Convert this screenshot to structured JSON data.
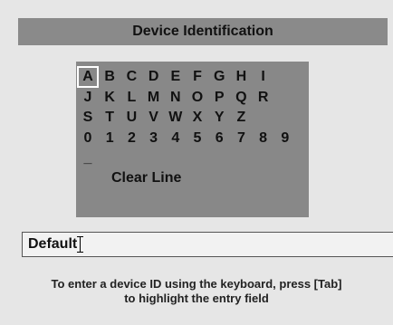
{
  "title": "Device Identification",
  "keyboard": {
    "rows": [
      [
        "A",
        "B",
        "C",
        "D",
        "E",
        "F",
        "G",
        "H",
        "I"
      ],
      [
        "J",
        "K",
        "L",
        "M",
        "N",
        "O",
        "P",
        "Q",
        "R"
      ],
      [
        "S",
        "T",
        "U",
        "V",
        "W",
        "X",
        "Y",
        "Z"
      ],
      [
        "0",
        "1",
        "2",
        "3",
        "4",
        "5",
        "6",
        "7",
        "8",
        "9"
      ],
      [
        "_"
      ]
    ],
    "selected": "A",
    "clear_line_label": "Clear Line"
  },
  "entry": {
    "value": "Default"
  },
  "instructions": {
    "line1": "To enter a device ID using the keyboard, press [Tab]",
    "line2": "to highlight the entry field"
  }
}
